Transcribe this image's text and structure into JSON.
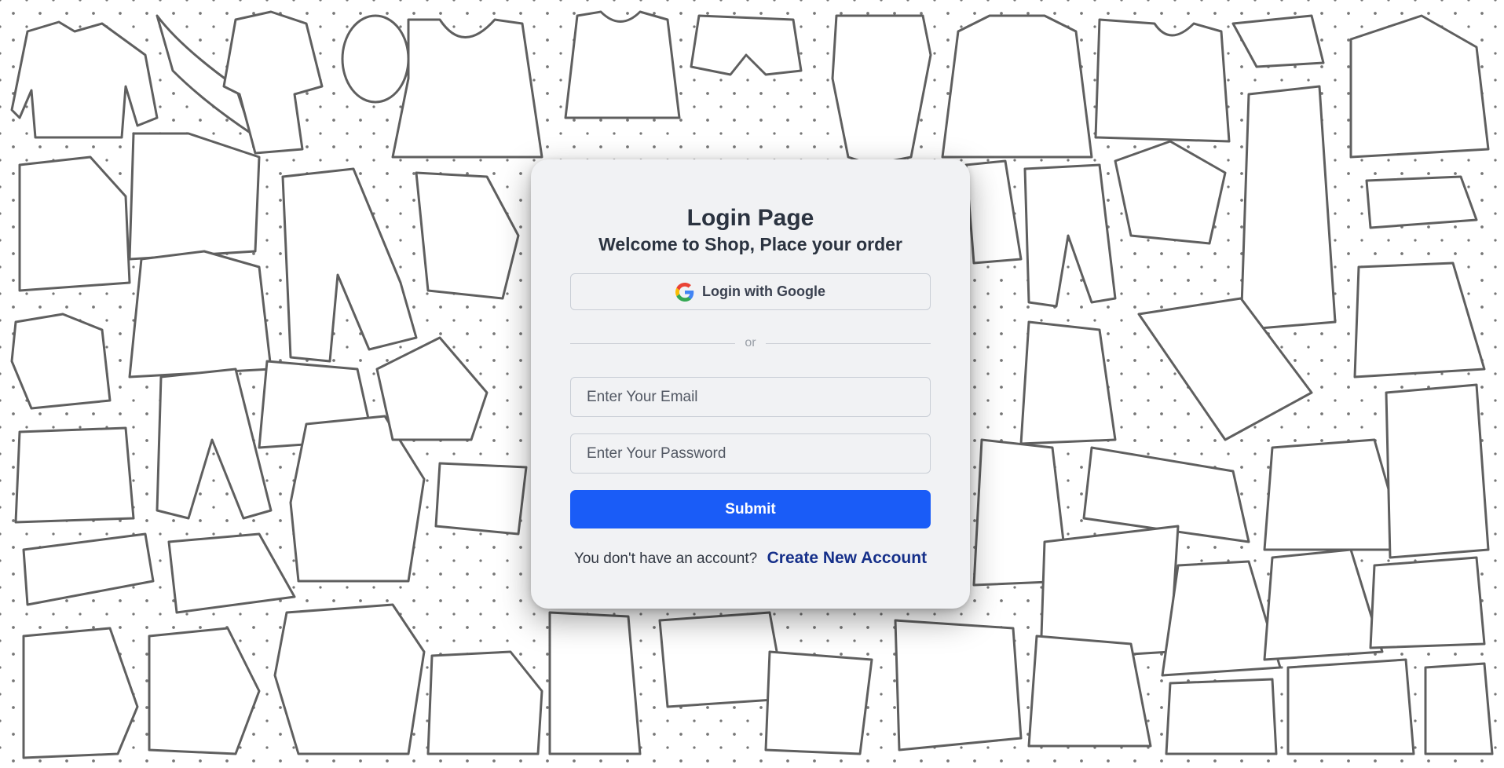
{
  "login": {
    "title": "Login Page",
    "subtitle": "Welcome to Shop, Place your order",
    "google_button_label": "Login with Google",
    "divider_text": "or",
    "email_placeholder": "Enter Your Email",
    "password_placeholder": "Enter Your Password",
    "submit_label": "Submit",
    "signup_prompt": "You don't have an account?",
    "signup_link": "Create New Account"
  },
  "colors": {
    "primary_button": "#1a5cf7",
    "link": "#16308a",
    "card_background": "#f1f2f4",
    "doodle_stroke": "#5f5f5f"
  },
  "background": {
    "icon": "clothing-doodle-pattern"
  }
}
